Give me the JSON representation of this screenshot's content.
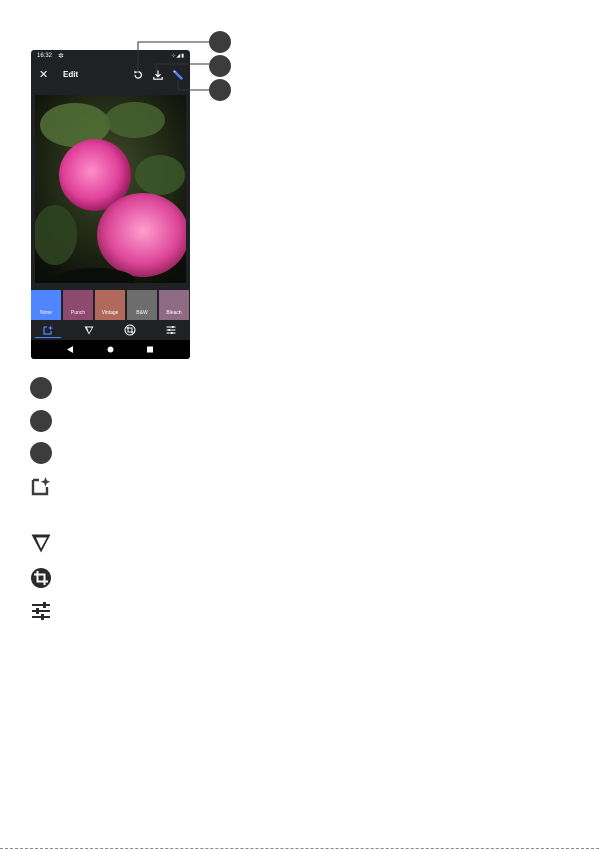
{
  "phone": {
    "status_time": "16:32",
    "status_icons": "⊹◢▮",
    "app_title": "Edit",
    "filters": [
      {
        "label": "None",
        "bg": "#4f86ff"
      },
      {
        "label": "Punch",
        "bg": "#8e4a6e"
      },
      {
        "label": "Vintage",
        "bg": "#b0695a"
      },
      {
        "label": "B&W",
        "bg": "#6d6d6d"
      },
      {
        "label": "Bleach",
        "bg": "#8e6a84"
      }
    ],
    "accent_color": "#4f86ff",
    "icons": {
      "close": "close-icon",
      "undo": "undo-icon",
      "save": "download-icon",
      "auto": "magic-wand-icon"
    }
  },
  "legend": [
    {
      "icon": "callout-bullet-1",
      "text": ""
    },
    {
      "icon": "callout-bullet-2",
      "text": ""
    },
    {
      "icon": "callout-bullet-3",
      "text": ""
    },
    {
      "icon": "auto-enhance-icon",
      "text": ""
    },
    {
      "icon": "filters-icon",
      "text": ""
    },
    {
      "icon": "crop-rotate-icon",
      "text": ""
    },
    {
      "icon": "adjust-sliders-icon",
      "text": ""
    }
  ]
}
